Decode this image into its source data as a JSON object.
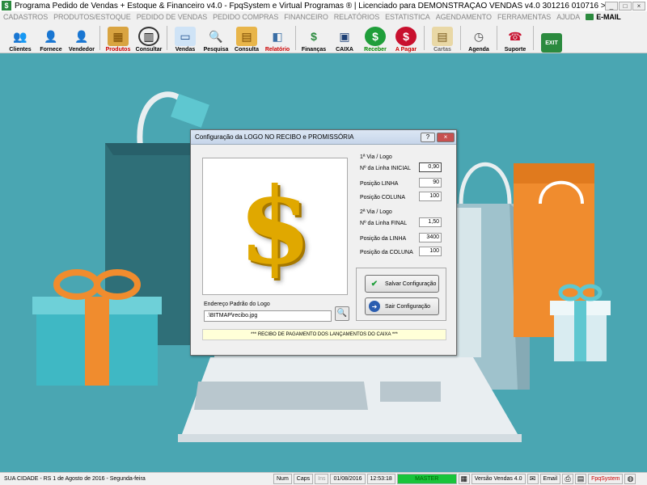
{
  "window": {
    "title": "Programa Pedido de Vendas + Estoque & Financeiro v4.0 - FpqSystem e Virtual Programas ® | Licenciado para  DEMONSTRAÇÃO VENDAS v4.0 301216 010716 >>>",
    "minimize": "_",
    "maximize": "□",
    "close": "×"
  },
  "menu": {
    "items": [
      {
        "label": "CADASTROS"
      },
      {
        "label": "PRODUTOS/ESTOQUE"
      },
      {
        "label": "PEDIDO DE VENDAS"
      },
      {
        "label": "PEDIDO COMPRAS"
      },
      {
        "label": "FINANCEIRO"
      },
      {
        "label": "RELATÓRIOS"
      },
      {
        "label": "ESTATISTICA"
      },
      {
        "label": "AGENDAMENTO"
      },
      {
        "label": "FERRAMENTAS"
      },
      {
        "label": "AJUDA"
      }
    ],
    "email": "E-MAIL"
  },
  "toolbar": {
    "clientes": "Clientes",
    "fornece": "Fornece",
    "vendedor": "Vendedor",
    "produtos": "Produtos",
    "consultar": "Consultar",
    "vendas": "Vendas",
    "pesquisa": "Pesquisa",
    "consulta": "Consulta",
    "relatorio": "Relatório",
    "financas": "Finanças",
    "caixa": "CAIXA",
    "receber": "Receber",
    "apagar": "A Pagar",
    "cartas": "Cartas",
    "agenda": "Agenda",
    "suporte": "Suporte",
    "exit": "EXIT"
  },
  "dialog": {
    "title": "Configuração da LOGO NO RECIBO e PROMISSÓRIA",
    "help": "?",
    "close": "×",
    "logo_symbol": "$",
    "via1": {
      "title": "1ª Via / Logo",
      "linha_inicial_label": "Nº da Linha INICIAL",
      "linha_inicial_value": "0,90",
      "posicao_linha_label": "Posição LINHA",
      "posicao_linha_value": "90",
      "posicao_coluna_label": "Posição COLUNA",
      "posicao_coluna_value": "100"
    },
    "via2": {
      "title": "2ª Via / Logo",
      "linha_final_label": "Nº da Linha FINAL",
      "linha_final_value": "1,50",
      "posicao_linha_label": "Posição da LINHA",
      "posicao_linha_value": "3400",
      "posicao_coluna_label": "Posição da COLUNA",
      "posicao_coluna_value": "100"
    },
    "address_label": "Endereço Padrão do Logo",
    "address_value": ".\\BITMAP\\recibo.jpg",
    "save_button": "Salvar Configuração",
    "exit_button": "Sair Configuração",
    "footer": "*** RECIBO DE PAGAMENTO DOS LANÇAMENTOS DO CAIXA ***"
  },
  "status": {
    "location_date": "SUA CIDADE - RS   1 de Agosto de 2016 - Segunda-feira",
    "num": "Num",
    "caps": "Caps",
    "ins": "Ins",
    "date": "01/08/2016",
    "time": "12:53:18",
    "user": "MASTER",
    "version": "Versão Vendas 4.0",
    "email": "Email",
    "brand": "FpqSystem"
  },
  "colors": {
    "background": "#4aa6b2",
    "master_green": "#19c43b",
    "dollar_gold": "#e0a800"
  }
}
